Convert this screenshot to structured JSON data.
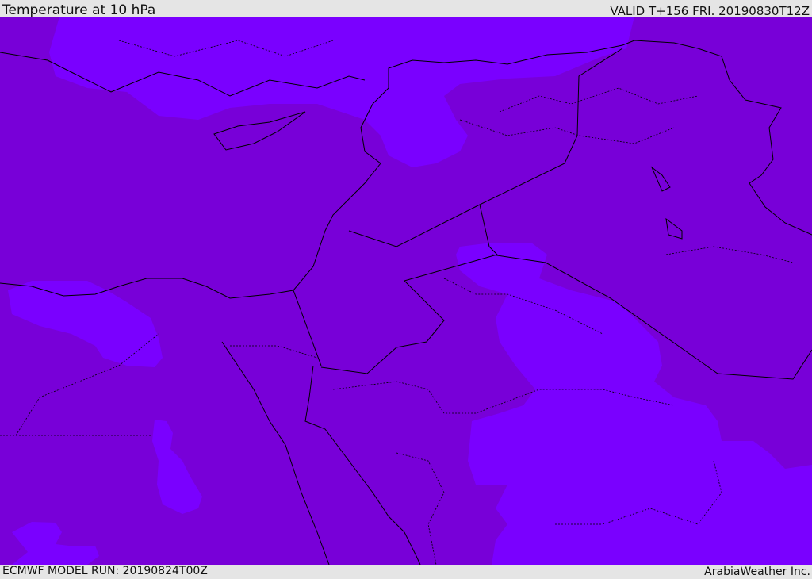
{
  "header": {
    "title": "Temperature at 10 hPa",
    "valid": "VALID T+156 FRI. 20190830T12Z"
  },
  "footer": {
    "model_run": "ECMWF MODEL RUN: 20190824T00Z",
    "brand": "ArabiaWeather Inc."
  },
  "map": {
    "colors": {
      "warm_band": "#7800d8",
      "cool_band": "#7a00ff",
      "lines": "#000000"
    }
  }
}
